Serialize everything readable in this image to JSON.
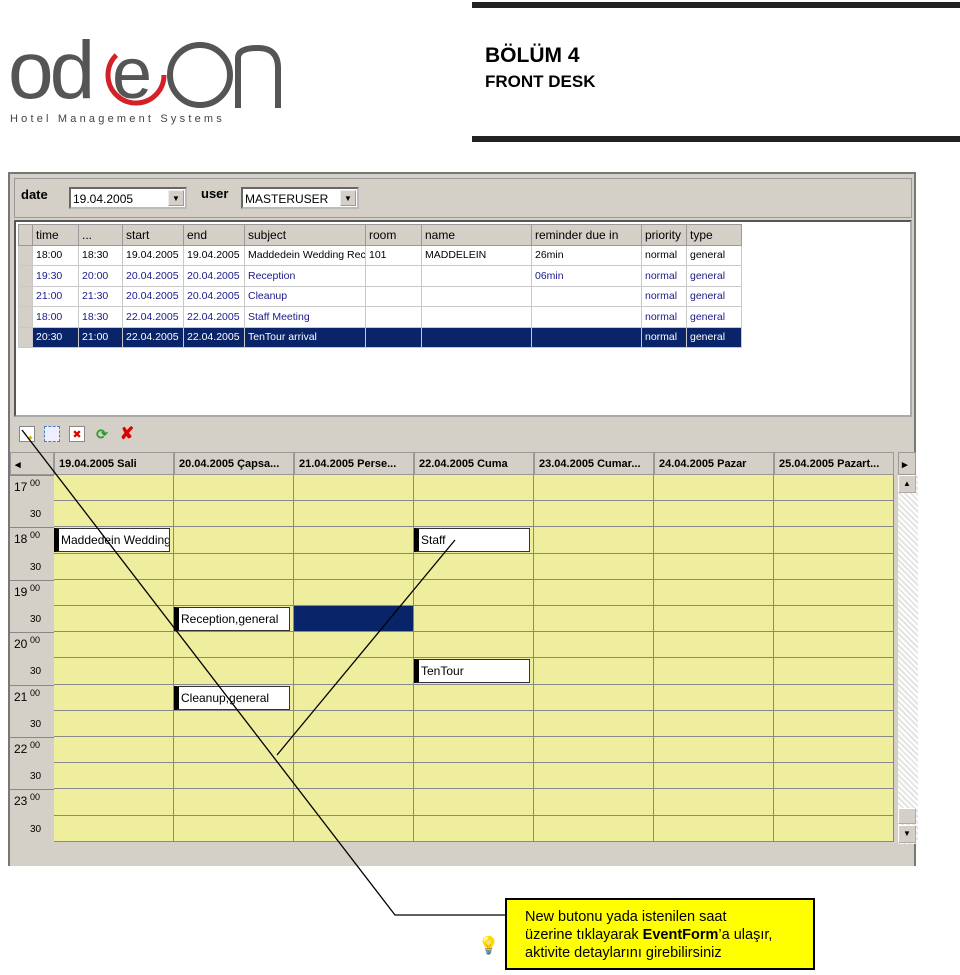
{
  "logo": {
    "brand": "odeon",
    "tagline": "Hotel Management Systems",
    "accent": "#d42027"
  },
  "header": {
    "chapter": "BÖLÜM 4",
    "section": "FRONT DESK"
  },
  "filter": {
    "date_label": "date",
    "date_value": "19.04.2005",
    "user_label": "user",
    "user_value": "MASTERUSER"
  },
  "table": {
    "columns": [
      "time",
      "...",
      "start",
      "end",
      "subject",
      "room",
      "name",
      "reminder due in",
      "priority",
      "type"
    ],
    "rows": [
      [
        "18:00",
        "18:30",
        "19.04.2005",
        "19.04.2005",
        "Maddedein Wedding Rece",
        "101",
        "MADDELEIN",
        "26min",
        "normal",
        "general"
      ],
      [
        "19:30",
        "20:00",
        "20.04.2005",
        "20.04.2005",
        "Reception",
        "",
        "",
        "06min",
        "normal",
        "general"
      ],
      [
        "21:00",
        "21:30",
        "20.04.2005",
        "20.04.2005",
        "Cleanup",
        "",
        "",
        "",
        "normal",
        "general"
      ],
      [
        "18:00",
        "18:30",
        "22.04.2005",
        "22.04.2005",
        "Staff Meeting",
        "",
        "",
        "",
        "normal",
        "general"
      ],
      [
        "20:30",
        "21:00",
        "22.04.2005",
        "22.04.2005",
        "TenTour arrival",
        "",
        "",
        "",
        "normal",
        "general"
      ]
    ],
    "selected_row": 4
  },
  "toolbar": [
    "new-icon",
    "select-icon",
    "delete-icon",
    "refresh-icon",
    "cancel-icon"
  ],
  "calendar": {
    "days": [
      "19.04.2005 Sali",
      "20.04.2005 Çapsa...",
      "21.04.2005 Perse...",
      "22.04.2005 Cuma",
      "23.04.2005 Cumar...",
      "24.04.2005 Pazar",
      "25.04.2005 Pazart..."
    ],
    "hours": [
      "17",
      "18",
      "19",
      "20",
      "21",
      "22",
      "23"
    ],
    "minutes": [
      "00",
      "30"
    ],
    "events": [
      {
        "label": "Maddedein Wedding",
        "day": 0,
        "slot": 2
      },
      {
        "label": "Staff",
        "day": 3,
        "slot": 2
      },
      {
        "label": "Reception,general",
        "day": 1,
        "slot": 5
      },
      {
        "label": "TenTour",
        "day": 3,
        "slot": 7
      },
      {
        "label": "Cleanup,general",
        "day": 1,
        "slot": 8
      }
    ],
    "selected_cell": {
      "day": 2,
      "slot": 5
    },
    "cell_color": "#eeee9e",
    "selection_color": "#0a246a"
  },
  "note": {
    "line1": "New butonu yada istenilen saat",
    "line2_pre": "üzerine tıklayarak ",
    "line2_bold": "EventForm",
    "line2_post": "’a ulaşır,",
    "line3": "aktivite detaylarını girebilirsiniz"
  }
}
